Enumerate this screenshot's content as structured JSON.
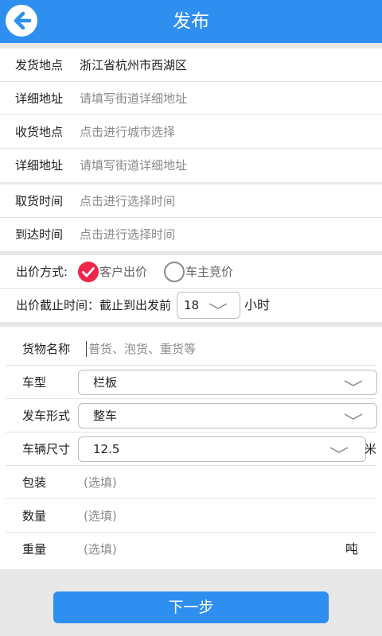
{
  "header": {
    "title": "发布"
  },
  "route": [
    {
      "label": "发货地点",
      "value": "浙江省杭州市西湖区",
      "placeholder": ""
    },
    {
      "label": "详细地址",
      "value": "",
      "placeholder": "请填写街道详细地址"
    },
    {
      "label": "收货地点",
      "value": "",
      "placeholder": "点击进行城市选择"
    },
    {
      "label": "详细地址",
      "value": "",
      "placeholder": "请填写街道详细地址"
    }
  ],
  "time": [
    {
      "label": "取货时间",
      "placeholder": "点击进行选择时间"
    },
    {
      "label": "到达时间",
      "placeholder": "点击进行选择时间"
    }
  ],
  "pricing": {
    "label": "出价方式:",
    "option_customer": "客户出价",
    "option_driver": "车主竞价",
    "selected": "option_customer",
    "deadline_label": "出价截止时间：截止到出发前",
    "deadline_value": "18",
    "deadline_unit": "小时"
  },
  "cargo": {
    "name_label": "货物名称",
    "name_placeholder": "普货、泡货、重货等",
    "vehicle_type_label": "车型",
    "vehicle_type_value": "栏板",
    "dispatch_label": "发车形式",
    "dispatch_value": "整车",
    "size_label": "车辆尺寸",
    "size_value": "12.5",
    "size_unit": "米",
    "packing_label": "包装",
    "packing_placeholder": "(选填)",
    "quantity_label": "数量",
    "quantity_placeholder": "(选填)",
    "weight_label": "重量",
    "weight_placeholder": "(选填)",
    "weight_unit": "吨"
  },
  "footer": {
    "next_label": "下一步"
  },
  "colors": {
    "accent": "#2e8ff0",
    "check": "#f0264a"
  },
  "icons": {
    "back": "back-arrow-icon",
    "dropdown": "chevron-down-icon",
    "check": "check-icon"
  }
}
